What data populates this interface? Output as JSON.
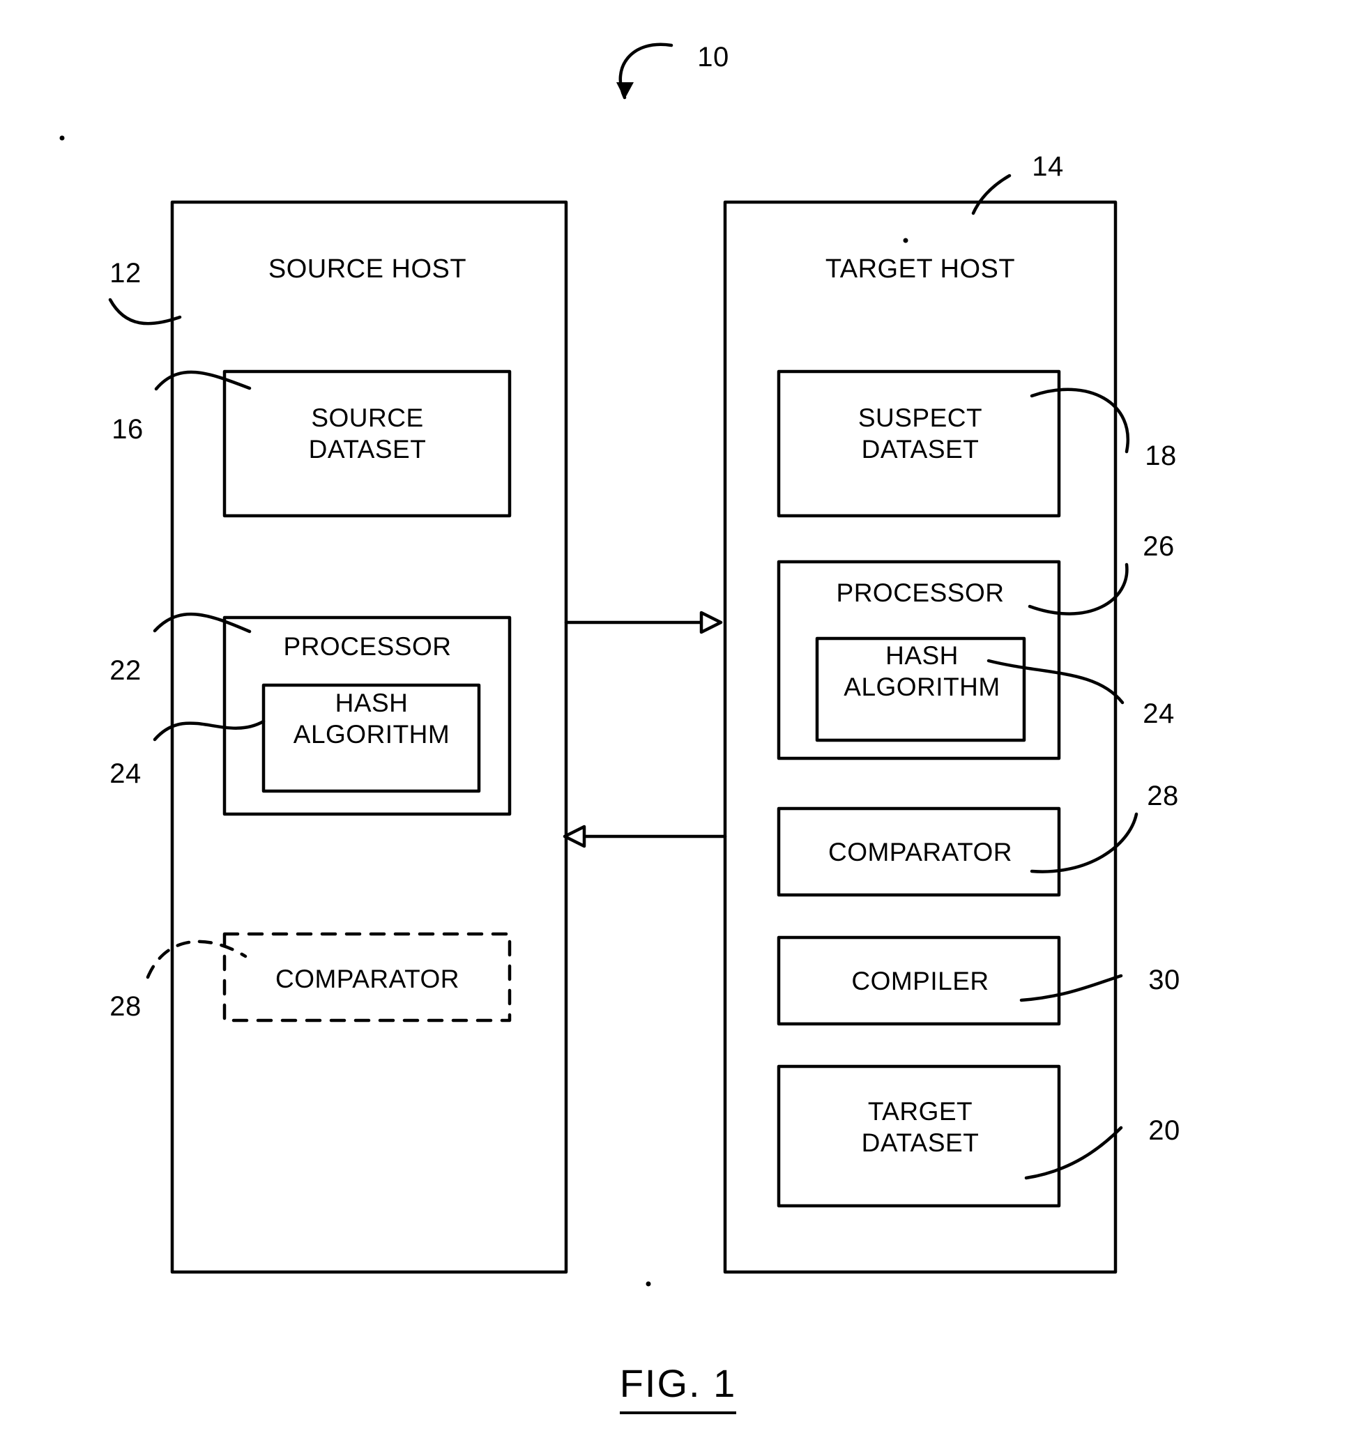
{
  "figure": {
    "caption": "FIG. 1",
    "system_ref": "10"
  },
  "hosts": [
    {
      "id": "source-host",
      "title": "SOURCE HOST",
      "ref": "12",
      "blocks": [
        {
          "id": "source-dataset",
          "label": "SOURCE\nDATASET",
          "ref": "16",
          "style": "solid"
        },
        {
          "id": "source-processor",
          "label": "PROCESSOR",
          "ref": "22",
          "style": "solid"
        },
        {
          "id": "source-hash-algorithm",
          "label": "HASH\nALGORITHM",
          "ref": "24",
          "style": "solid"
        },
        {
          "id": "source-comparator",
          "label": "COMPARATOR",
          "ref": "28",
          "style": "dashed"
        }
      ]
    },
    {
      "id": "target-host",
      "title": "TARGET HOST",
      "ref": "14",
      "blocks": [
        {
          "id": "suspect-dataset",
          "label": "SUSPECT\nDATASET",
          "ref": "18",
          "style": "solid"
        },
        {
          "id": "target-processor",
          "label": "PROCESSOR",
          "ref": "26",
          "style": "solid"
        },
        {
          "id": "target-hash-algorithm",
          "label": "HASH\nALGORITHM",
          "ref": "24",
          "style": "solid"
        },
        {
          "id": "target-comparator",
          "label": "COMPARATOR",
          "ref": "28",
          "style": "solid"
        },
        {
          "id": "target-compiler",
          "label": "COMPILER",
          "ref": "30",
          "style": "solid"
        },
        {
          "id": "target-dataset",
          "label": "TARGET\nDATASET",
          "ref": "20",
          "style": "solid"
        }
      ]
    }
  ],
  "connections": [
    {
      "id": "source-to-target",
      "direction": "right"
    },
    {
      "id": "target-to-source",
      "direction": "left"
    }
  ],
  "colors": {
    "ink": "#000000",
    "paper": "#ffffff"
  }
}
